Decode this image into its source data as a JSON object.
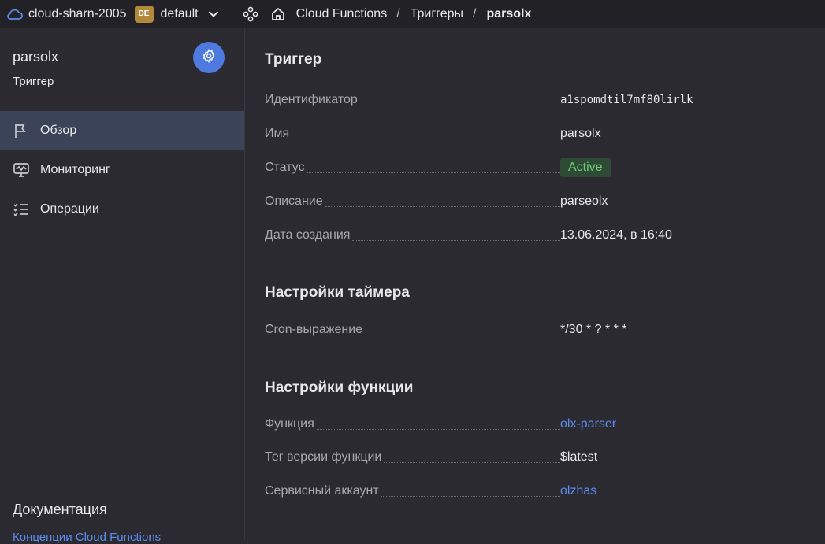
{
  "header": {
    "cloud_name": "cloud-sharn-2005",
    "folder_badge": "DE",
    "folder_name": "default",
    "breadcrumbs": [
      "Cloud Functions",
      "Триггеры",
      "parsolx"
    ],
    "separator": "/"
  },
  "sidebar": {
    "resource_name": "parsolx",
    "resource_type": "Триггер",
    "nav": [
      {
        "label": "Обзор",
        "icon": "flag-icon",
        "active": true
      },
      {
        "label": "Мониторинг",
        "icon": "monitoring-icon",
        "active": false
      },
      {
        "label": "Операции",
        "icon": "operations-list-icon",
        "active": false
      }
    ],
    "docs_title": "Документация",
    "docs_link": "Концепции Cloud Functions"
  },
  "main": {
    "trigger_title": "Триггер",
    "details": [
      {
        "key": "Идентификатор",
        "value": "a1spomdtil7mf80lirlk"
      },
      {
        "key": "Имя",
        "value": "parsolx"
      },
      {
        "key": "Статус",
        "value": "Active"
      },
      {
        "key": "Описание",
        "value": "parseolx"
      },
      {
        "key": "Дата создания",
        "value": "13.06.2024, в 16:40"
      }
    ],
    "timer_title": "Настройки таймера",
    "timer": [
      {
        "key": "Cron-выражение",
        "value": "*/30 * ? * * *"
      }
    ],
    "function_title": "Настройки функции",
    "function": [
      {
        "key": "Функция",
        "value": "olx-parser"
      },
      {
        "key": "Тег версии функции",
        "value": "$latest"
      },
      {
        "key": "Сервисный аккаунт",
        "value": "olzhas"
      }
    ]
  },
  "colors": {
    "accent": "#4e7ae0",
    "link": "#5e8cf0",
    "status_active_bg": "#2e4a34",
    "status_active_text": "#6fcf7c",
    "nav_active_bg": "#3a4357"
  }
}
